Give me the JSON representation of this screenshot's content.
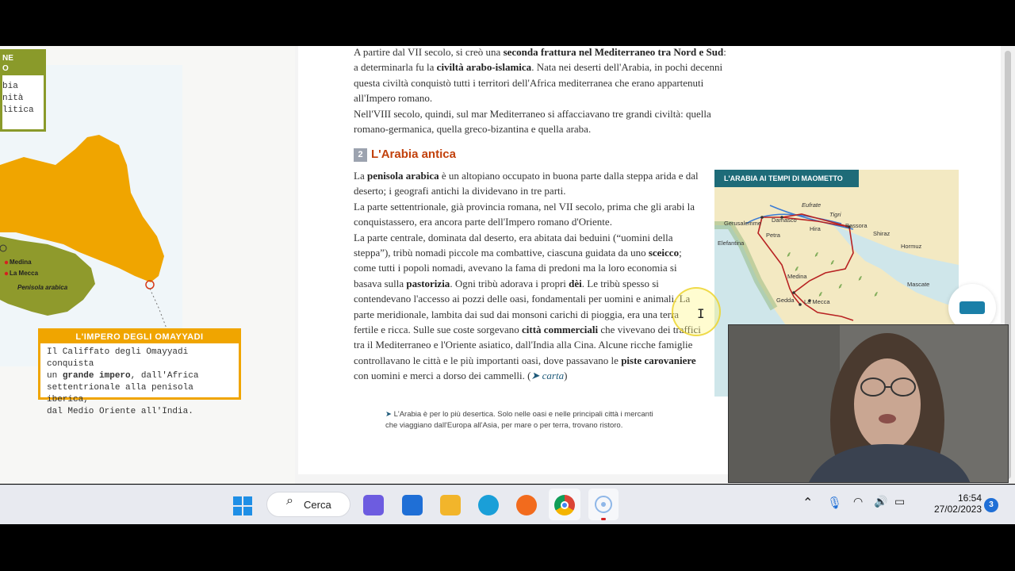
{
  "left_page": {
    "legend": {
      "head_line1": "NE",
      "head_line2": "O",
      "items": [
        "bia",
        "nità",
        "litica"
      ]
    },
    "map_labels": {
      "medina": "Medina",
      "mecca": "La Mecca",
      "peninsula": "Penisola arabica"
    },
    "omayyadi": {
      "title": "L'IMPERO DEGLI OMAYYADI",
      "line1": "Il Califfato degli Omayyadi conquista",
      "line2_pre": "un ",
      "line2_bold": "grande impero",
      "line2_post": ", dall'Africa",
      "line3": "settentrionale alla penisola iberica,",
      "line4": "dal Medio Oriente all'India."
    }
  },
  "right_page": {
    "intro": {
      "t1": "A partire dal VII secolo, si creò una ",
      "b1": "seconda frattura nel Mediterraneo tra Nord e Sud",
      "t2": ": a determinarla fu la ",
      "b2": "civiltà arabo-islamica",
      "t3": ". Nata nei deserti dell'Arabia, in pochi decenni questa civiltà conquistò tutti i territori dell'Africa mediterranea che erano appartenuti all'Impero romano.",
      "t4": "Nell'VIII secolo, quindi, sul mar Mediterraneo si affacciavano tre grandi civiltà: quella romano-germanica, quella greco-bizantina e quella araba."
    },
    "section": {
      "number": "2",
      "title": "L'Arabia antica"
    },
    "body": {
      "p1a": "La ",
      "p1b": "penisola arabica",
      "p1c": " è un altopiano occupato in buona parte dalla steppa arida e dal deserto; i geografi antichi la dividevano in tre parti.",
      "p2": "La parte settentrionale, già provincia romana, nel VII secolo, prima che gli arabi la conquistassero, era ancora parte dell'Impero romano d'Oriente.",
      "p3a": "La parte centrale, dominata dal deserto, era abitata dai beduini (“uomini della steppa”), tribù nomadi piccole ma combattive, ciascuna guidata da uno ",
      "p3b": "sceicco",
      "p3c": "; come tutti i popoli nomadi, avevano la fama di predoni ma la loro economia si basava sulla ",
      "p3d": "pastorizia",
      "p3e": ". Ogni tribù adorava i propri ",
      "p3f": "dèi",
      "p3g": ". Le tribù spesso si contendevano l'accesso ai pozzi delle oasi, fondamentali per uomini e animali. La parte meridionale, lambita dai sud dai monsoni carichi di pioggia, era una terra fertile e ricca. Sulle sue coste sorgevano ",
      "p3h": "città commerciali",
      "p3i": " che vivevano dei traffici tra il Mediterraneo e l'Oriente asiatico, dall'India alla Cina. Alcune ricche famiglie controllavano le città e le più importanti oasi, dove passavano le ",
      "p3j": "piste carovaniere",
      "p3k": " con uomini e merci a dorso dei cammelli. (",
      "p3l": "carta",
      "p3m": ")"
    },
    "caption": {
      "line1": "L'Arabia è per lo più desertica. Solo nelle oasi e nelle principali città i mercanti",
      "line2": "che viaggiano dall'Europa all'Asia, per mare o per terra, trovano ristoro."
    },
    "map": {
      "title": "L'ARABIA AI TEMPI DI MAOMETTO",
      "labels": {
        "gerusalemme": "Gerusalemme",
        "damasco": "Damasco",
        "petra": "Petra",
        "eufrate": "Eufrate",
        "tigri": "Tigri",
        "hira": "Hira",
        "bassora": "Bassora",
        "shiraz": "Shiraz",
        "hormuz": "Hormuz",
        "elefantina": "Elefantina",
        "medina": "Medina",
        "gedda": "Gedda",
        "mecca": "La Mecca",
        "mascate": "Mascate"
      }
    }
  },
  "taskbar": {
    "search_label": "Cerca",
    "time": "16:54",
    "date": "27/02/2023",
    "notification_count": "3"
  }
}
